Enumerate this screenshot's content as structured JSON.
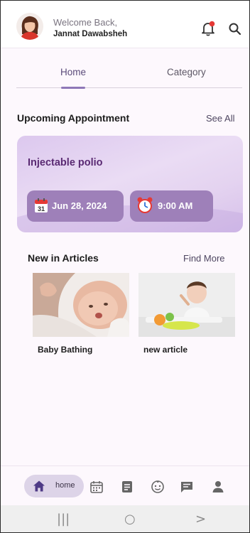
{
  "header": {
    "welcome": "Welcome Back,",
    "user_name": "Jannat Dawabsheh",
    "notification_dot_color": "#e53935"
  },
  "tabs": [
    {
      "label": "Home",
      "active": true
    },
    {
      "label": "Category",
      "active": false
    }
  ],
  "appointments": {
    "section_title": "Upcoming Appointment",
    "see_all": "See All",
    "card": {
      "title": "Injectable polio",
      "calendar_day": "31",
      "date": "Jun 28, 2024",
      "time": "9:00 AM"
    }
  },
  "articles": {
    "section_title": "New in Articles",
    "find_more": "Find More",
    "items": [
      {
        "title": "Baby Bathing",
        "image": "baby-bathing-photo"
      },
      {
        "title": "new article",
        "image": "baby-eating-photo"
      }
    ]
  },
  "bottom_nav": {
    "items": [
      {
        "label": "home",
        "icon": "home-icon",
        "active": true
      },
      {
        "icon": "calendar-icon"
      },
      {
        "icon": "document-icon"
      },
      {
        "icon": "baby-face-icon"
      },
      {
        "icon": "chat-icon"
      },
      {
        "icon": "profile-icon"
      }
    ],
    "accent_color": "#4e3a86"
  },
  "system_nav": {
    "recents": "|||",
    "home": "○",
    "back": ">"
  },
  "colors": {
    "accent": "#8f78b8",
    "card_gradient": "#e4d3f0",
    "pill": "#9e80b9",
    "appointment_title": "#5a2a73"
  }
}
